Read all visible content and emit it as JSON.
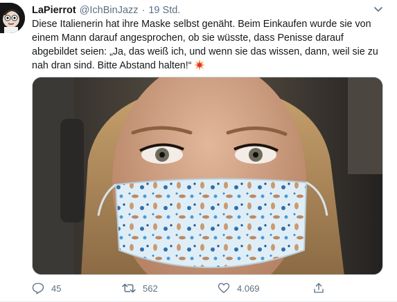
{
  "tweet": {
    "display_name": "LaPierrot",
    "handle": "@IchBinJazz",
    "separator": "·",
    "time": "19 Std.",
    "text": "Diese Italienerin hat ihre Maske selbst genäht. Beim Einkaufen wurde sie von einem Mann darauf angesprochen, ob sie wüsste, dass Penisse darauf abgebildet seien: „Ja, das weiß ich, und wenn sie das wissen, dann, weil sie zu nah dran sind. Bitte Abstand halten!“",
    "text_emoji": "collision-emoji",
    "media_icon": "photo-woman-with-patterned-mask"
  },
  "actions": {
    "reply": {
      "icon": "reply-icon",
      "count": "45"
    },
    "retweet": {
      "icon": "retweet-icon",
      "count": "562"
    },
    "like": {
      "icon": "heart-icon",
      "count": "4.069"
    },
    "share": {
      "icon": "share-icon"
    }
  },
  "colors": {
    "secondary_text": "#5b7083",
    "primary_text": "#14171a",
    "divider": "#e6ecf0"
  }
}
